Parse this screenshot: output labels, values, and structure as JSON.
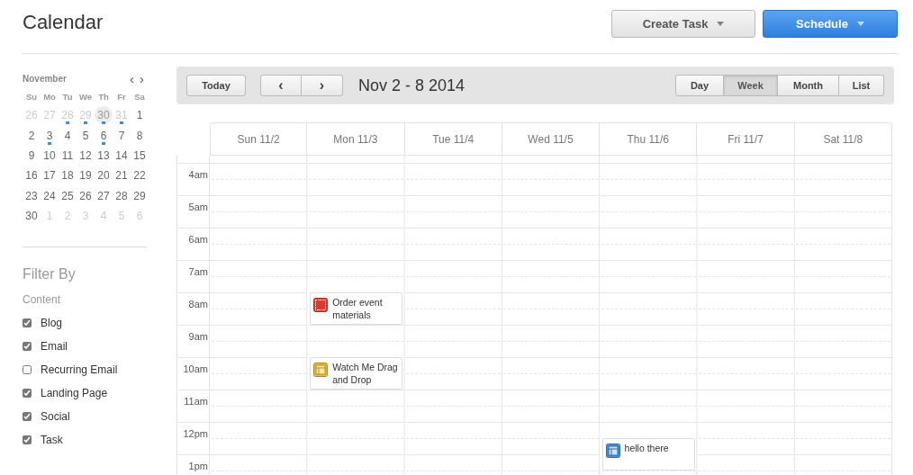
{
  "page": {
    "title": "Calendar"
  },
  "header_buttons": [
    {
      "label": "Create Task",
      "kind": "secondary"
    },
    {
      "label": "Schedule",
      "kind": "primary"
    }
  ],
  "mini_calendar": {
    "month": "November",
    "prev": "‹",
    "next": "›",
    "weekdays": [
      "Su",
      "Mo",
      "Tu",
      "We",
      "Th",
      "Fr",
      "Sa"
    ],
    "weeks": [
      [
        {
          "label": "26",
          "muted": true,
          "today": false,
          "has_items": false
        },
        {
          "label": "27",
          "muted": true,
          "today": false,
          "has_items": false
        },
        {
          "label": "28",
          "muted": true,
          "today": false,
          "has_items": true
        },
        {
          "label": "29",
          "muted": true,
          "today": false,
          "has_items": true
        },
        {
          "label": "30",
          "muted": true,
          "today": true,
          "has_items": true
        },
        {
          "label": "31",
          "muted": true,
          "today": false,
          "has_items": true
        },
        {
          "label": "1",
          "muted": false,
          "today": false,
          "has_items": false
        }
      ],
      [
        {
          "label": "2",
          "muted": false,
          "today": false,
          "has_items": false
        },
        {
          "label": "3",
          "muted": false,
          "today": false,
          "has_items": true
        },
        {
          "label": "4",
          "muted": false,
          "today": false,
          "has_items": false
        },
        {
          "label": "5",
          "muted": false,
          "today": false,
          "has_items": false
        },
        {
          "label": "6",
          "muted": false,
          "today": false,
          "has_items": true
        },
        {
          "label": "7",
          "muted": false,
          "today": false,
          "has_items": false
        },
        {
          "label": "8",
          "muted": false,
          "today": false,
          "has_items": false
        }
      ],
      [
        {
          "label": "9",
          "muted": false,
          "today": false,
          "has_items": false
        },
        {
          "label": "10",
          "muted": false,
          "today": false,
          "has_items": false
        },
        {
          "label": "11",
          "muted": false,
          "today": false,
          "has_items": false
        },
        {
          "label": "12",
          "muted": false,
          "today": false,
          "has_items": false
        },
        {
          "label": "13",
          "muted": false,
          "today": false,
          "has_items": false
        },
        {
          "label": "14",
          "muted": false,
          "today": false,
          "has_items": false
        },
        {
          "label": "15",
          "muted": false,
          "today": false,
          "has_items": false
        }
      ],
      [
        {
          "label": "16",
          "muted": false,
          "today": false,
          "has_items": false
        },
        {
          "label": "17",
          "muted": false,
          "today": false,
          "has_items": false
        },
        {
          "label": "18",
          "muted": false,
          "today": false,
          "has_items": false
        },
        {
          "label": "19",
          "muted": false,
          "today": false,
          "has_items": false
        },
        {
          "label": "20",
          "muted": false,
          "today": false,
          "has_items": false
        },
        {
          "label": "21",
          "muted": false,
          "today": false,
          "has_items": false
        },
        {
          "label": "22",
          "muted": false,
          "today": false,
          "has_items": false
        }
      ],
      [
        {
          "label": "23",
          "muted": false,
          "today": false,
          "has_items": false
        },
        {
          "label": "24",
          "muted": false,
          "today": false,
          "has_items": false
        },
        {
          "label": "25",
          "muted": false,
          "today": false,
          "has_items": false
        },
        {
          "label": "26",
          "muted": false,
          "today": false,
          "has_items": false
        },
        {
          "label": "27",
          "muted": false,
          "today": false,
          "has_items": false
        },
        {
          "label": "28",
          "muted": false,
          "today": false,
          "has_items": false
        },
        {
          "label": "29",
          "muted": false,
          "today": false,
          "has_items": false
        }
      ],
      [
        {
          "label": "30",
          "muted": false,
          "today": false,
          "has_items": false
        },
        {
          "label": "1",
          "muted": true,
          "today": false,
          "has_items": false
        },
        {
          "label": "2",
          "muted": true,
          "today": false,
          "has_items": false
        },
        {
          "label": "3",
          "muted": true,
          "today": false,
          "has_items": false
        },
        {
          "label": "4",
          "muted": true,
          "today": false,
          "has_items": false
        },
        {
          "label": "5",
          "muted": true,
          "today": false,
          "has_items": false
        },
        {
          "label": "6",
          "muted": true,
          "today": false,
          "has_items": false
        }
      ]
    ]
  },
  "filter": {
    "title": "Filter By",
    "group": "Content",
    "items": [
      {
        "label": "Blog",
        "checked": true
      },
      {
        "label": "Email",
        "checked": true
      },
      {
        "label": "Recurring Email",
        "checked": false
      },
      {
        "label": "Landing Page",
        "checked": true
      },
      {
        "label": "Social",
        "checked": true
      },
      {
        "label": "Task",
        "checked": true
      }
    ]
  },
  "toolbar": {
    "today": "Today",
    "prev": "‹",
    "next": "›",
    "range": "Nov 2 - 8 2014",
    "views": [
      {
        "label": "Day",
        "selected": false
      },
      {
        "label": "Week",
        "selected": true
      },
      {
        "label": "Month",
        "selected": false
      },
      {
        "label": "List",
        "selected": false
      }
    ]
  },
  "days": [
    {
      "label": "Sun 11/2"
    },
    {
      "label": "Mon 11/3"
    },
    {
      "label": "Tue 11/4"
    },
    {
      "label": "Wed 11/5"
    },
    {
      "label": "Thu 11/6"
    },
    {
      "label": "Fri 11/7"
    },
    {
      "label": "Sat 11/8"
    }
  ],
  "hours": [
    {
      "label": "4am"
    },
    {
      "label": "5am"
    },
    {
      "label": "6am"
    },
    {
      "label": "7am"
    },
    {
      "label": "8am",
      "slots": [
        {
          "booked": false
        },
        {
          "booked": true,
          "event": {
            "kind": "task",
            "title": "Order event materials",
            "half_past": false
          }
        },
        {
          "booked": false
        },
        {
          "booked": false
        },
        {
          "booked": false
        },
        {
          "booked": false
        },
        {
          "booked": false
        }
      ]
    },
    {
      "label": "9am"
    },
    {
      "label": "10am",
      "slots": [
        {
          "booked": false
        },
        {
          "booked": true,
          "event": {
            "kind": "landing_page",
            "title": "Watch Me Drag and Drop",
            "half_past": false
          }
        },
        {
          "booked": false
        },
        {
          "booked": false
        },
        {
          "booked": false
        },
        {
          "booked": false
        },
        {
          "booked": false
        }
      ]
    },
    {
      "label": "11am"
    },
    {
      "label": "12pm",
      "slots": [
        {
          "booked": false
        },
        {
          "booked": false
        },
        {
          "booked": false
        },
        {
          "booked": false
        },
        {
          "booked": true,
          "event": {
            "kind": "email",
            "title": "hello there",
            "half_past": true
          }
        },
        {
          "booked": false
        },
        {
          "booked": false
        }
      ]
    },
    {
      "label": "1pm"
    }
  ]
}
